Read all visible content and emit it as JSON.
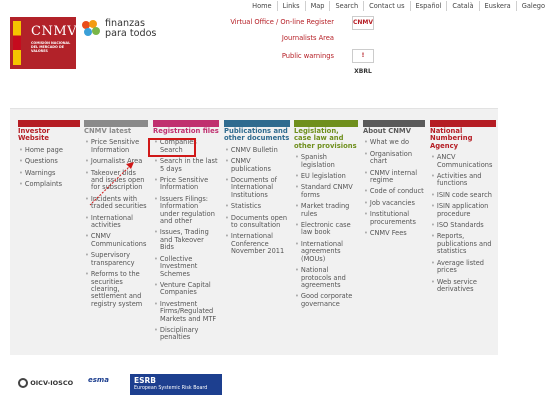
{
  "top_nav": [
    "Home",
    "Links",
    "Map",
    "Search",
    "Contact us",
    "Español",
    "Català",
    "Euskera",
    "Galego"
  ],
  "logo": {
    "name": "CNMV",
    "subtitle": "COMISIÓN NACIONAL DEL MERCADO DE VALORES"
  },
  "finanzas": {
    "line1": "finanzas",
    "line2": "para todos"
  },
  "right_links": {
    "virtual_office": "Virtual Office / On-line Register",
    "journalists_area": "Journalists Area",
    "public_warnings": "Public warnings",
    "icon1_label": "CNMV",
    "icon2_label": "!",
    "icon3_label": "XBRL"
  },
  "columns": [
    {
      "title": "Investor Website",
      "color": "#b51d24",
      "items": [
        "Home page",
        "Questions",
        "Warnings",
        "Complaints"
      ]
    },
    {
      "title": "CNMV latest",
      "color": "#8a8a8a",
      "items": [
        "Price Sensitive Information",
        "Journalists Area",
        "Takeover bids and issues open for subscription",
        "Incidents with traded securities",
        "International activities",
        "CNMV Communications",
        "Supervisory transparency",
        "Reforms to the securities clearing, settlement and registry system"
      ]
    },
    {
      "title": "Registration files",
      "color": "#c0306f",
      "items": [
        "Companies Search",
        "Search in the last 5 days",
        "Price Sensitive Information",
        "Issuers Filings: Information under regulation and other",
        "Issues, Trading and Takeover Bids",
        "Collective Investment Schemes",
        "Venture Capital Companies",
        "Investment Firms/Regulated Markets and MTF",
        "Disciplinary penalties"
      ]
    },
    {
      "title": "Publications and other documents",
      "color": "#2f6b8f",
      "items": [
        "CNMV Bulletin",
        "CNMV publications",
        "Documents of International Institutions",
        "Statistics",
        "Documents open to consultation",
        "International Conference November 2011"
      ]
    },
    {
      "title": "Legislation, case law and other provisions",
      "color": "#6f8f1d",
      "items": [
        "Spanish legislation",
        "EU legislation",
        "Standard CNMV forms",
        "Market trading rules",
        "Electronic case law book",
        "International agreements (MOUs)",
        "National protocols and agreements",
        "Good corporate governance"
      ]
    },
    {
      "title": "About CNMV",
      "color": "#5a5a5a",
      "items": [
        "What we do",
        "Organisation chart",
        "CNMV internal regime",
        "Code of conduct",
        "Job vacancies",
        "Institutional procurements",
        "CNMV Fees"
      ]
    },
    {
      "title": "National Numbering Agency",
      "color": "#b51d24",
      "items": [
        "ANCV Communications",
        "Activities and functions",
        "ISIN code search",
        "ISIN application procedure",
        "ISO Standards",
        "Reports, publications and statistics",
        "Average listed prices",
        "Web service derivatives"
      ]
    }
  ],
  "footer": {
    "oicv": "OICV-IOSCO",
    "esma": "esma",
    "esrb_title": "ESRB",
    "esrb_sub": "European Systemic Risk Board"
  }
}
